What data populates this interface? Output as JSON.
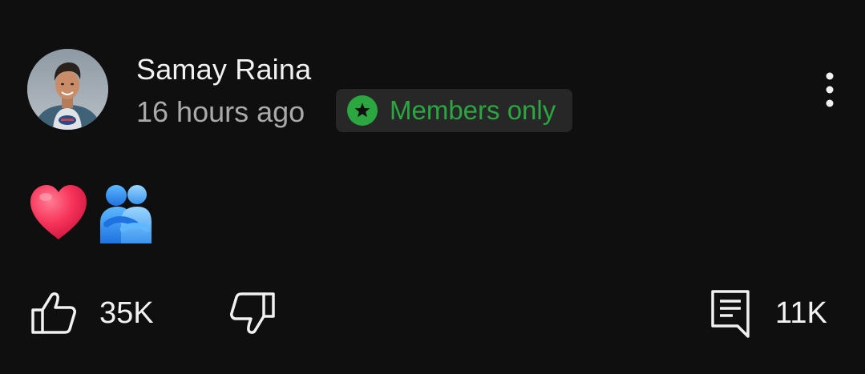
{
  "post": {
    "author": "Samay Raina",
    "timestamp": "16 hours ago",
    "badge": {
      "label": "Members only",
      "icon": "star-icon",
      "color": "#2ba640"
    },
    "menu_icon": "more-vert-icon",
    "content": {
      "emojis": [
        "red-heart-emoji",
        "people-hugging-emoji"
      ]
    }
  },
  "actions": {
    "like_icon": "thumbs-up-icon",
    "like_count": "35K",
    "dislike_icon": "thumbs-down-icon",
    "comment_icon": "comment-icon",
    "comment_count": "11K"
  },
  "colors": {
    "background": "#0f0f0f",
    "primary_text": "#f1f1f1",
    "secondary_text": "#aaaaaa",
    "badge_background": "#272727"
  }
}
